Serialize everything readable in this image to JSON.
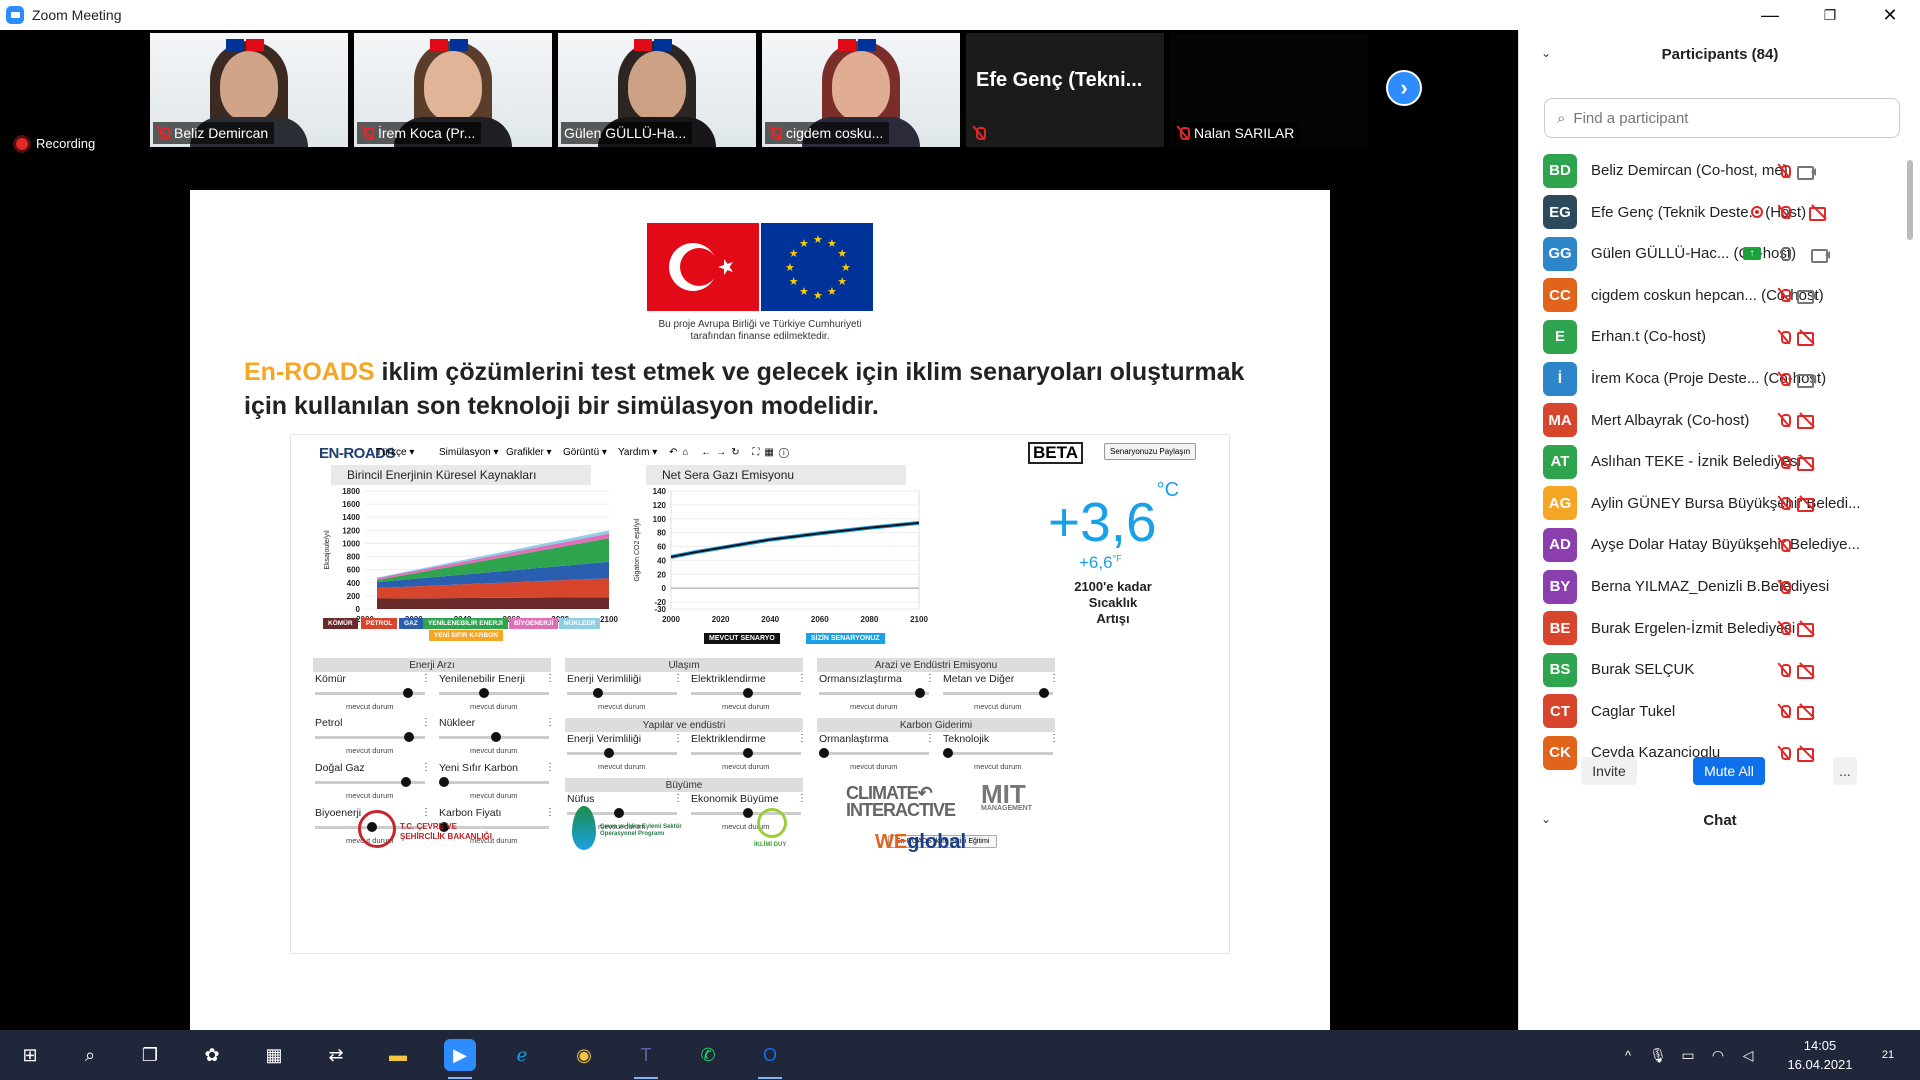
{
  "window": {
    "title": "Zoom Meeting",
    "min": "—",
    "restore": "❐",
    "close": "✕"
  },
  "thumbs": [
    {
      "name": "Beliz Demircan"
    },
    {
      "name": "İrem Koca (Pr..."
    },
    {
      "name": "Gülen GÜLLÜ-Ha..."
    },
    {
      "name": "cigdem cosku..."
    },
    {
      "name": "Efe Genç (Tekni..."
    },
    {
      "name": "Nalan SARILAR"
    }
  ],
  "recording": "Recording",
  "slide": {
    "caption1": "Bu proje Avrupa Birliği ve Türkiye Cumhuriyeti",
    "caption2": "tarafından finanse edilmektedir.",
    "headline_accent": "En-ROADS",
    "headline_rest": " iklim çözümlerini test etmek ve gelecek için iklim senaryoları oluşturmak için kullanılan son teknoloji bir simülasyon modelidir.",
    "sim": {
      "logo": "EN-ROADS",
      "menu": [
        "Türkçe ▾",
        "Simülasyon ▾",
        "Grafikler ▾",
        "Görüntü ▾",
        "Yardım ▾"
      ],
      "beta": "BETA",
      "share": "Senaryonuzu Paylaşın",
      "panel1": "Birincil Enerjinin Küresel Kaynakları",
      "panel2": "Net Sera Gazı Emisyonu",
      "temp_c": "+3,6",
      "temp_c_unit": "°C",
      "temp_f": "+6,6",
      "temp_f_unit": "°F",
      "temp_label1": "2100'e kadar",
      "temp_label2": "Sıcaklık",
      "temp_label3": "Artışı",
      "legend": [
        {
          "label": "KÖMÜR",
          "color": "#6b2a2a"
        },
        {
          "label": "PETROL",
          "color": "#d8452d"
        },
        {
          "label": "GAZ",
          "color": "#2a5fb0"
        },
        {
          "label": "YENİLENEBİLİR ENERJİ",
          "color": "#2ea44f"
        },
        {
          "label": "BİYOENERJİ",
          "color": "#e06fb7"
        },
        {
          "label": "NÜKLEER",
          "color": "#8ecfe6"
        },
        {
          "label": "YENİ SIFIR KARBON",
          "color": "#f5a623"
        }
      ],
      "scenario_current": "MEVCUT SENARYO",
      "scenario_yours": "SİZİN SENARYONUZ",
      "sections": {
        "enerji": "Enerji Arzı",
        "ulasim": "Ulaşım",
        "arazi": "Arazi ve Endüstri Emisyonu",
        "yapilar": "Yapılar ve endüstri",
        "karbon": "Karbon Giderimi",
        "buyume": "Büyüme"
      },
      "sliders": {
        "komur": "Kömür",
        "yenilenebilir": "Yenilenebilir Enerji",
        "petrol": "Petrol",
        "nukleer": "Nükleer",
        "dogalgaz": "Doğal Gaz",
        "sifirkarbon": "Yeni Sıfır Karbon",
        "biyoenerji": "Biyoenerji",
        "karbonfiyati": "Karbon Fiyatı",
        "u_verim": "Enerji Verimliliği",
        "u_elek": "Elektriklendirme",
        "y_verim": "Enerji Verimliliği",
        "y_elek": "Elektriklendirme",
        "nufus": "Nüfus",
        "ekonomi": "Ekonomik Büyüme",
        "ormansiz": "Ormansızlaştırma",
        "metan": "Metan ve Diğer",
        "orman": "Ormanlaştırma",
        "teknoloji": "Teknolojik"
      },
      "status": "mevcut durum",
      "logo_ci": "CLIMATE INTERACTIVE",
      "logo_mit_small": "MANAGEMENT",
      "ambassador": "En-ROADS İklim Elçisi Eğitimi"
    },
    "partners": {
      "bakanlik": "T.C. ÇEVRE VE ŞEHİRCİLİK BAKANLIĞI",
      "program": "Çevre ve İklim Eylemi Sektör Operasyonel Programı",
      "iklimduy": "İKLİMİ DUY",
      "we": "WE",
      "global": "global"
    }
  },
  "chart_data": [
    {
      "type": "area",
      "title": "Birincil Enerjinin Küresel Kaynakları",
      "ylabel": "Eksajoule/yıl",
      "xlim": [
        2000,
        2100
      ],
      "ylim": [
        0,
        1800
      ],
      "x": [
        2000,
        2100
      ],
      "yticks": [
        0,
        200,
        400,
        600,
        800,
        1000,
        1200,
        1400,
        1600,
        1800
      ],
      "xticks": [
        2000,
        2020,
        2040,
        2060,
        2080,
        2100
      ],
      "series": [
        {
          "name": "KÖMÜR",
          "values": [
            160,
            180
          ]
        },
        {
          "name": "PETROL",
          "values": [
            160,
            290
          ]
        },
        {
          "name": "GAZ",
          "values": [
            90,
            250
          ]
        },
        {
          "name": "YENİLENEBİLİR ENERJİ",
          "values": [
            30,
            360
          ]
        },
        {
          "name": "BİYOENERJİ",
          "values": [
            30,
            70
          ]
        },
        {
          "name": "NÜKLEER",
          "values": [
            10,
            50
          ]
        }
      ]
    },
    {
      "type": "line",
      "title": "Net Sera Gazı Emisyonu",
      "ylabel": "Gigaton CO2 eşd/yıl",
      "xlim": [
        2000,
        2100
      ],
      "ylim": [
        -30,
        140
      ],
      "yticks": [
        -30,
        -20,
        0,
        20,
        40,
        60,
        80,
        100,
        120,
        140
      ],
      "xticks": [
        2000,
        2020,
        2040,
        2060,
        2080,
        2100
      ],
      "series": [
        {
          "name": "MEVCUT SENARYO",
          "x": [
            2000,
            2010,
            2020,
            2040,
            2060,
            2080,
            2100
          ],
          "values": [
            45,
            52,
            58,
            70,
            79,
            87,
            94
          ]
        }
      ]
    }
  ],
  "participants": {
    "header": "Participants (84)",
    "search_placeholder": "Find a participant",
    "list": [
      {
        "initials": "BD",
        "color": "#2ea44f",
        "name": "Beliz Demircan (Co-host, me)",
        "rec": false,
        "share": false,
        "mic": "off",
        "cam": "on"
      },
      {
        "initials": "EG",
        "color": "#2d4a5c",
        "name": "Efe Genç (Teknik Deste... (Host)",
        "rec": true,
        "share": false,
        "mic": "off",
        "cam": "off"
      },
      {
        "initials": "GG",
        "color": "#2d86c9",
        "name": "Gülen GÜLLÜ-Hac... (Co-host)",
        "rec": false,
        "share": true,
        "mic": "on",
        "cam": "on"
      },
      {
        "initials": "CC",
        "color": "#e2641b",
        "name": "cigdem coskun hepcan... (Co-host)",
        "rec": false,
        "share": false,
        "mic": "off",
        "cam": "on"
      },
      {
        "initials": "E",
        "color": "#2ea44f",
        "name": "Erhan.t (Co-host)",
        "rec": false,
        "share": false,
        "mic": "off",
        "cam": "off"
      },
      {
        "initials": "İ",
        "color": "#2d86c9",
        "name": "İrem Koca (Proje Deste... (Co-host)",
        "rec": false,
        "share": false,
        "mic": "off",
        "cam": "on"
      },
      {
        "initials": "MA",
        "color": "#d8452d",
        "name": "Mert Albayrak (Co-host)",
        "rec": false,
        "share": false,
        "mic": "off",
        "cam": "off"
      },
      {
        "initials": "AT",
        "color": "#2ea44f",
        "name": "Aslıhan TEKE - İznik Belediyesi",
        "rec": false,
        "share": false,
        "mic": "off",
        "cam": "off"
      },
      {
        "initials": "AG",
        "color": "#f5a623",
        "name": "Aylin GÜNEY Bursa Büyükşehir Beledi...",
        "rec": false,
        "share": false,
        "mic": "off",
        "cam": "off"
      },
      {
        "initials": "AD",
        "color": "#8b3fae",
        "name": "Ayşe Dolar Hatay Büyükşehir Belediye...",
        "rec": false,
        "share": false,
        "mic": "off",
        "cam": "none"
      },
      {
        "initials": "BY",
        "color": "#8b3fae",
        "name": "Berna YILMAZ_Denizli B.Belediyesi",
        "rec": false,
        "share": false,
        "mic": "off",
        "cam": "none"
      },
      {
        "initials": "BE",
        "color": "#d8452d",
        "name": "Burak Ergelen-İzmit Belediyesi",
        "rec": false,
        "share": false,
        "mic": "off",
        "cam": "off"
      },
      {
        "initials": "BS",
        "color": "#2ea44f",
        "name": "Burak SELÇUK",
        "rec": false,
        "share": false,
        "mic": "off",
        "cam": "off"
      },
      {
        "initials": "CT",
        "color": "#d8452d",
        "name": "Caglar Tukel",
        "rec": false,
        "share": false,
        "mic": "off",
        "cam": "off"
      },
      {
        "initials": "CK",
        "color": "#e2641b",
        "name": "Ceyda Kazancioglu",
        "rec": false,
        "share": false,
        "mic": "off",
        "cam": "off"
      }
    ],
    "invite": "Invite",
    "mute_all": "Mute All",
    "more": "...",
    "chat": "Chat"
  },
  "taskbar": {
    "time": "14:05",
    "date": "16.04.2021",
    "badge": "21"
  }
}
